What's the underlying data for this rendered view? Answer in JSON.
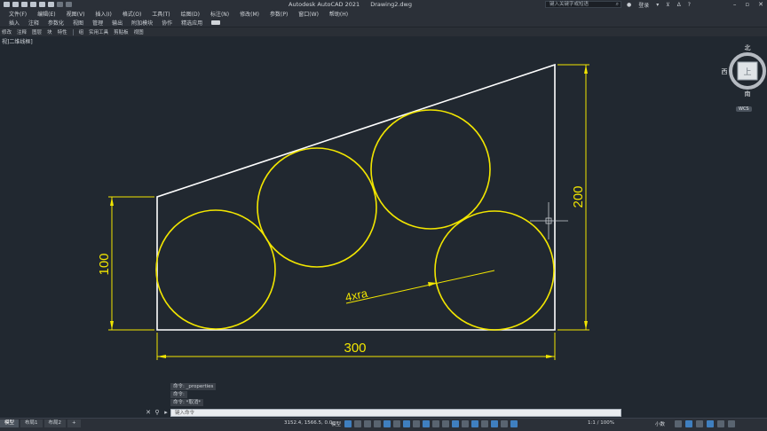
{
  "titlebar": {
    "app_name": "Autodesk AutoCAD 2021",
    "file_name": "Drawing2.dwg",
    "search_placeholder": "键入关键字或短语",
    "login_label": "登录"
  },
  "menu": [
    "文件(F)",
    "编辑(E)",
    "视图(V)",
    "插入(I)",
    "格式(O)",
    "工具(T)",
    "绘图(D)",
    "标注(N)",
    "修改(M)",
    "参数(P)",
    "窗口(W)",
    "帮助(H)"
  ],
  "ribbon_tabs": [
    "插入",
    "注释",
    "参数化",
    "视图",
    "管理",
    "输出",
    "附加模块",
    "协作",
    "精选应用"
  ],
  "panel_bar": [
    "修改",
    "注释",
    "图层",
    "块",
    "特性",
    "组",
    "实用工具",
    "剪贴板",
    "视图"
  ],
  "viewport_label": "视]二维线框]",
  "drawing": {
    "dim_bottom": "300",
    "dim_left": "100",
    "dim_right": "200",
    "leader_label": "4xra",
    "colors": {
      "outline": "#ffffff",
      "circles": "#f2e600",
      "dimensions": "#f2e600",
      "crosshair": "#c8cdd3"
    }
  },
  "viewcube": {
    "north": "北",
    "west": "西",
    "top_face": "上",
    "south": "南",
    "wcs": "WCS"
  },
  "command": {
    "history": [
      "命令: _properties",
      "命令:",
      "命令: *取消*"
    ],
    "placeholder": "键入命令"
  },
  "statusbar": {
    "tabs": [
      "模型",
      "布局1",
      "布局2"
    ],
    "add_tab": "+",
    "coords": "3152.4, 1566.5, 0.0",
    "model_label": "模型",
    "scale": "1:1 / 100%",
    "units": "小数"
  }
}
